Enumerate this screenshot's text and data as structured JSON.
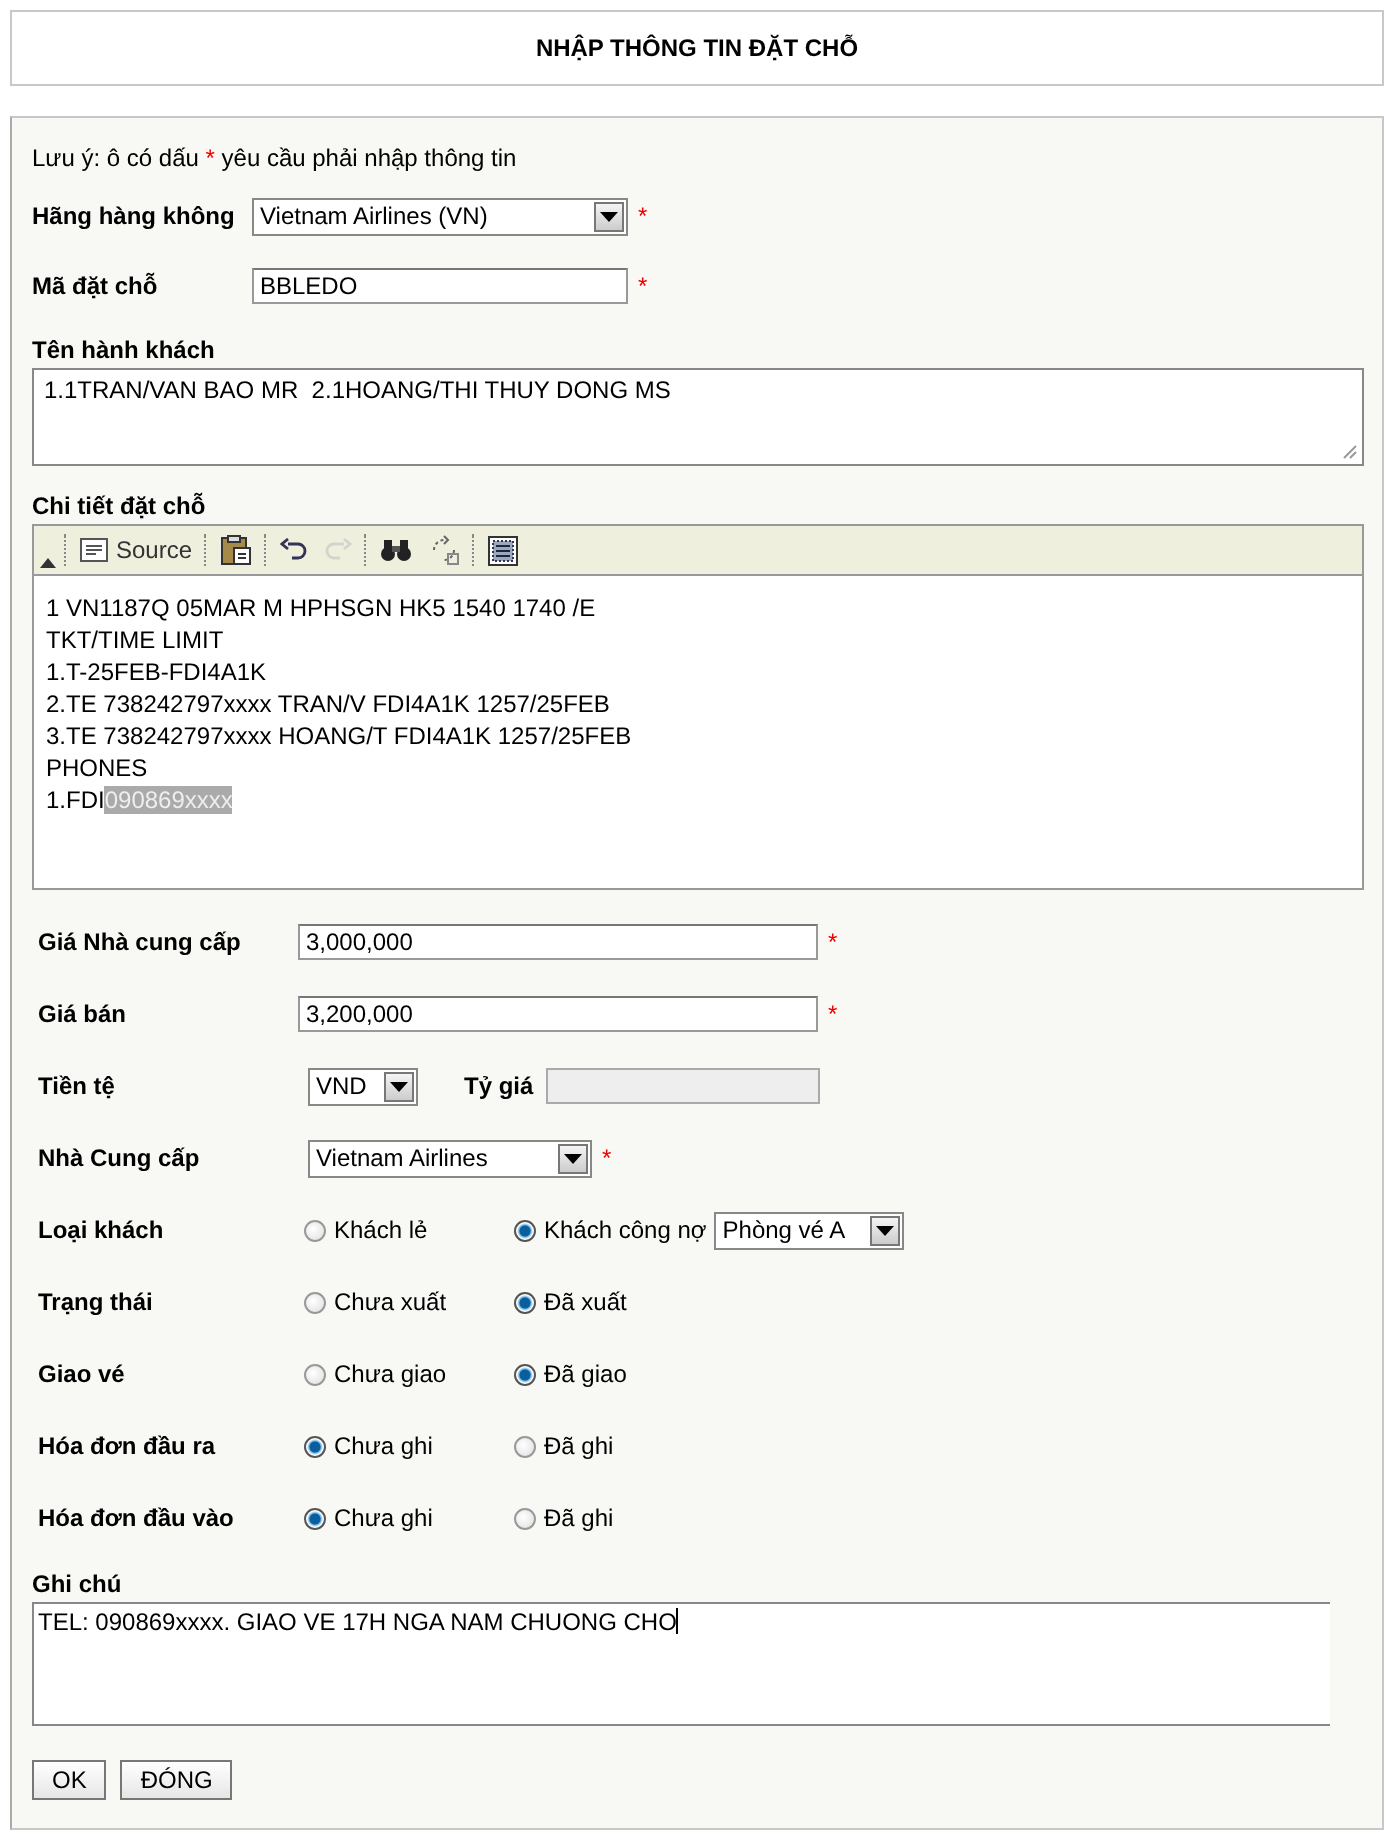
{
  "title": "NHẬP THÔNG TIN ĐẶT CHỖ",
  "note": {
    "before": "Lưu ý: ô có dấu",
    "mark": "*",
    "after": "yêu cầu phải nhập thông tin"
  },
  "top_fields": [
    {
      "kind": "select",
      "label": "Hãng hàng không",
      "value": "Vietnam Airlines (VN)",
      "mark": "*"
    },
    {
      "kind": "text",
      "label": "Mã đặt chỗ",
      "value": "BBLEDO",
      "mark": "*"
    }
  ],
  "passengers": {
    "label": "Tên hành khách",
    "value": "1.1TRAN/VAN BAO MR  2.1HOANG/THI THUY DONG MS"
  },
  "details": {
    "label": "Chi tiết đặt chỗ",
    "toolbar": [
      {
        "kind": "source",
        "label": "Source",
        "disabled": false
      },
      {
        "kind": "sep"
      },
      {
        "kind": "paste",
        "disabled": false
      },
      {
        "kind": "sep"
      },
      {
        "kind": "undo",
        "disabled": false
      },
      {
        "kind": "redo",
        "disabled": true
      },
      {
        "kind": "sep"
      },
      {
        "kind": "find",
        "disabled": false
      },
      {
        "kind": "replace",
        "disabled": false
      },
      {
        "kind": "sep"
      },
      {
        "kind": "selectall",
        "disabled": false
      }
    ],
    "lines": [
      {
        "text": "1 VN1187Q 05MAR M HPHSGN HK5 1540 1740 /E"
      },
      {
        "text": "TKT/TIME LIMIT"
      },
      {
        "text": "1.T-25FEB-FDI4A1K"
      },
      {
        "text": "2.TE 738242797xxxx TRAN/V FDI4A1K 1257/25FEB"
      },
      {
        "text": "3.TE 738242797xxxx HOANG/T FDI4A1K 1257/25FEB"
      },
      {
        "text": "PHONES"
      },
      {
        "text": "1.FDI",
        "highlighted": "090869xxxx"
      }
    ]
  },
  "fields": [
    {
      "kind": "text",
      "label": "Giá Nhà cung cấp",
      "value": "3,000,000",
      "mark": "*"
    },
    {
      "kind": "text",
      "label": "Giá bán",
      "value": "3,200,000",
      "mark": "*"
    },
    {
      "kind": "currency",
      "label": "Tiền tệ",
      "value": "VND",
      "rate_label": "Tỷ giá",
      "rate_disabled": true
    },
    {
      "kind": "select",
      "label": "Nhà Cung cấp",
      "value": "Vietnam Airlines",
      "mark": "*"
    },
    {
      "kind": "radio",
      "label": "Loại khách",
      "options": [
        {
          "label": "Khách lẻ",
          "selected": false
        },
        {
          "label": "Khách công nợ",
          "selected": true
        }
      ],
      "extra_select": "Phòng vé A"
    },
    {
      "kind": "radio",
      "label": "Trạng thái",
      "options": [
        {
          "label": "Chưa xuất",
          "selected": false
        },
        {
          "label": "Đã xuất",
          "selected": true
        }
      ]
    },
    {
      "kind": "radio",
      "label": "Giao vé",
      "options": [
        {
          "label": "Chưa giao",
          "selected": false
        },
        {
          "label": "Đã giao",
          "selected": true
        }
      ]
    },
    {
      "kind": "radio",
      "label": "Hóa đơn đầu ra",
      "options": [
        {
          "label": "Chưa ghi",
          "selected": true
        },
        {
          "label": "Đã ghi",
          "selected": false
        }
      ]
    },
    {
      "kind": "radio",
      "label": "Hóa đơn đầu vào",
      "options": [
        {
          "label": "Chưa ghi",
          "selected": true
        },
        {
          "label": "Đã ghi",
          "selected": false
        }
      ]
    }
  ],
  "remarks": {
    "label": "Ghi chú",
    "value": "TEL: 090869xxxx. GIAO VE 17H NGA NAM CHUONG CHO"
  },
  "buttons": [
    "OK",
    "ĐÓNG"
  ]
}
